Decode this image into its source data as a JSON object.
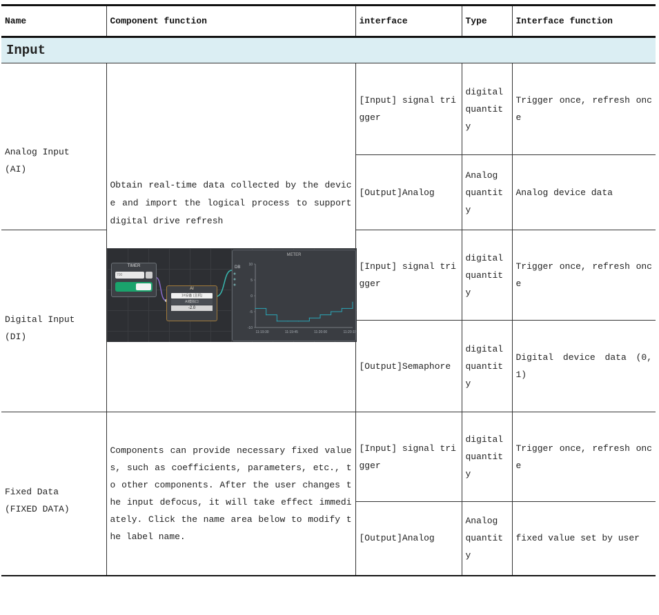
{
  "headers": [
    "Name",
    "Component function",
    "interface",
    "Type",
    "Interface function"
  ],
  "section": "Input",
  "ai": {
    "name_line1": "Analog Input",
    "name_line2": "(AI)",
    "description": "Obtain real-time data collected by the device and import the logical process to support digital drive refresh",
    "rows": [
      {
        "interface": "[Input] signal trigger",
        "type": "digital quantity",
        "function": "Trigger once, refresh once"
      },
      {
        "interface": "[Output]Analog",
        "type": "Analog quantity",
        "function": "Analog device data"
      }
    ]
  },
  "di": {
    "name_line1": "Digital Input",
    "name_line2": "(DI)",
    "rows": [
      {
        "interface": "[Input] signal trigger",
        "type": "digital quantity",
        "function": "Trigger once, refresh once"
      },
      {
        "interface": "[Output]Semaphore",
        "type": "digital quantity",
        "function": "Digital device data (0, 1)"
      }
    ]
  },
  "fixed": {
    "name_line1": "Fixed Data",
    "name_line2": "(FIXED DATA)",
    "description": "Components can provide necessary fixed values, such as coefficients, parameters, etc., to other components. After the user changes the input defocus, it will take effect immediately. Click the name area below to modify the label name.",
    "rows": [
      {
        "interface": "[Input] signal trigger",
        "type": "digital quantity",
        "function": "Trigger once, refresh once"
      },
      {
        "interface": "[Output]Analog",
        "type": "Analog quantity",
        "function": "fixed value set by user"
      }
    ]
  },
  "diagram": {
    "timer": {
      "title": "TIMER",
      "value": "700"
    },
    "ai_node": {
      "title": "AI",
      "device": "1#设备 (主机)",
      "channel": "AI模拟口",
      "value": "-2.0"
    },
    "meter": {
      "title": "METER",
      "port_label": "DB",
      "y_ticks": [
        "10",
        "5",
        "0",
        "-5",
        "-10"
      ],
      "x_ticks": [
        "11:19:30",
        "11:19:45",
        "11:20:00",
        "11:20:15"
      ]
    }
  },
  "chart_data": {
    "type": "line",
    "title": "METER",
    "x": [
      "11:19:30",
      "11:19:38",
      "11:19:45",
      "11:19:52",
      "11:20:00",
      "11:20:04",
      "11:20:08",
      "11:20:12",
      "11:20:15",
      "11:20:18"
    ],
    "values": [
      -4,
      -6,
      -8,
      -8,
      -8,
      -7,
      -6,
      -5,
      -4,
      -2
    ],
    "ylim": [
      -10,
      10
    ],
    "xlabel": "",
    "ylabel": ""
  }
}
